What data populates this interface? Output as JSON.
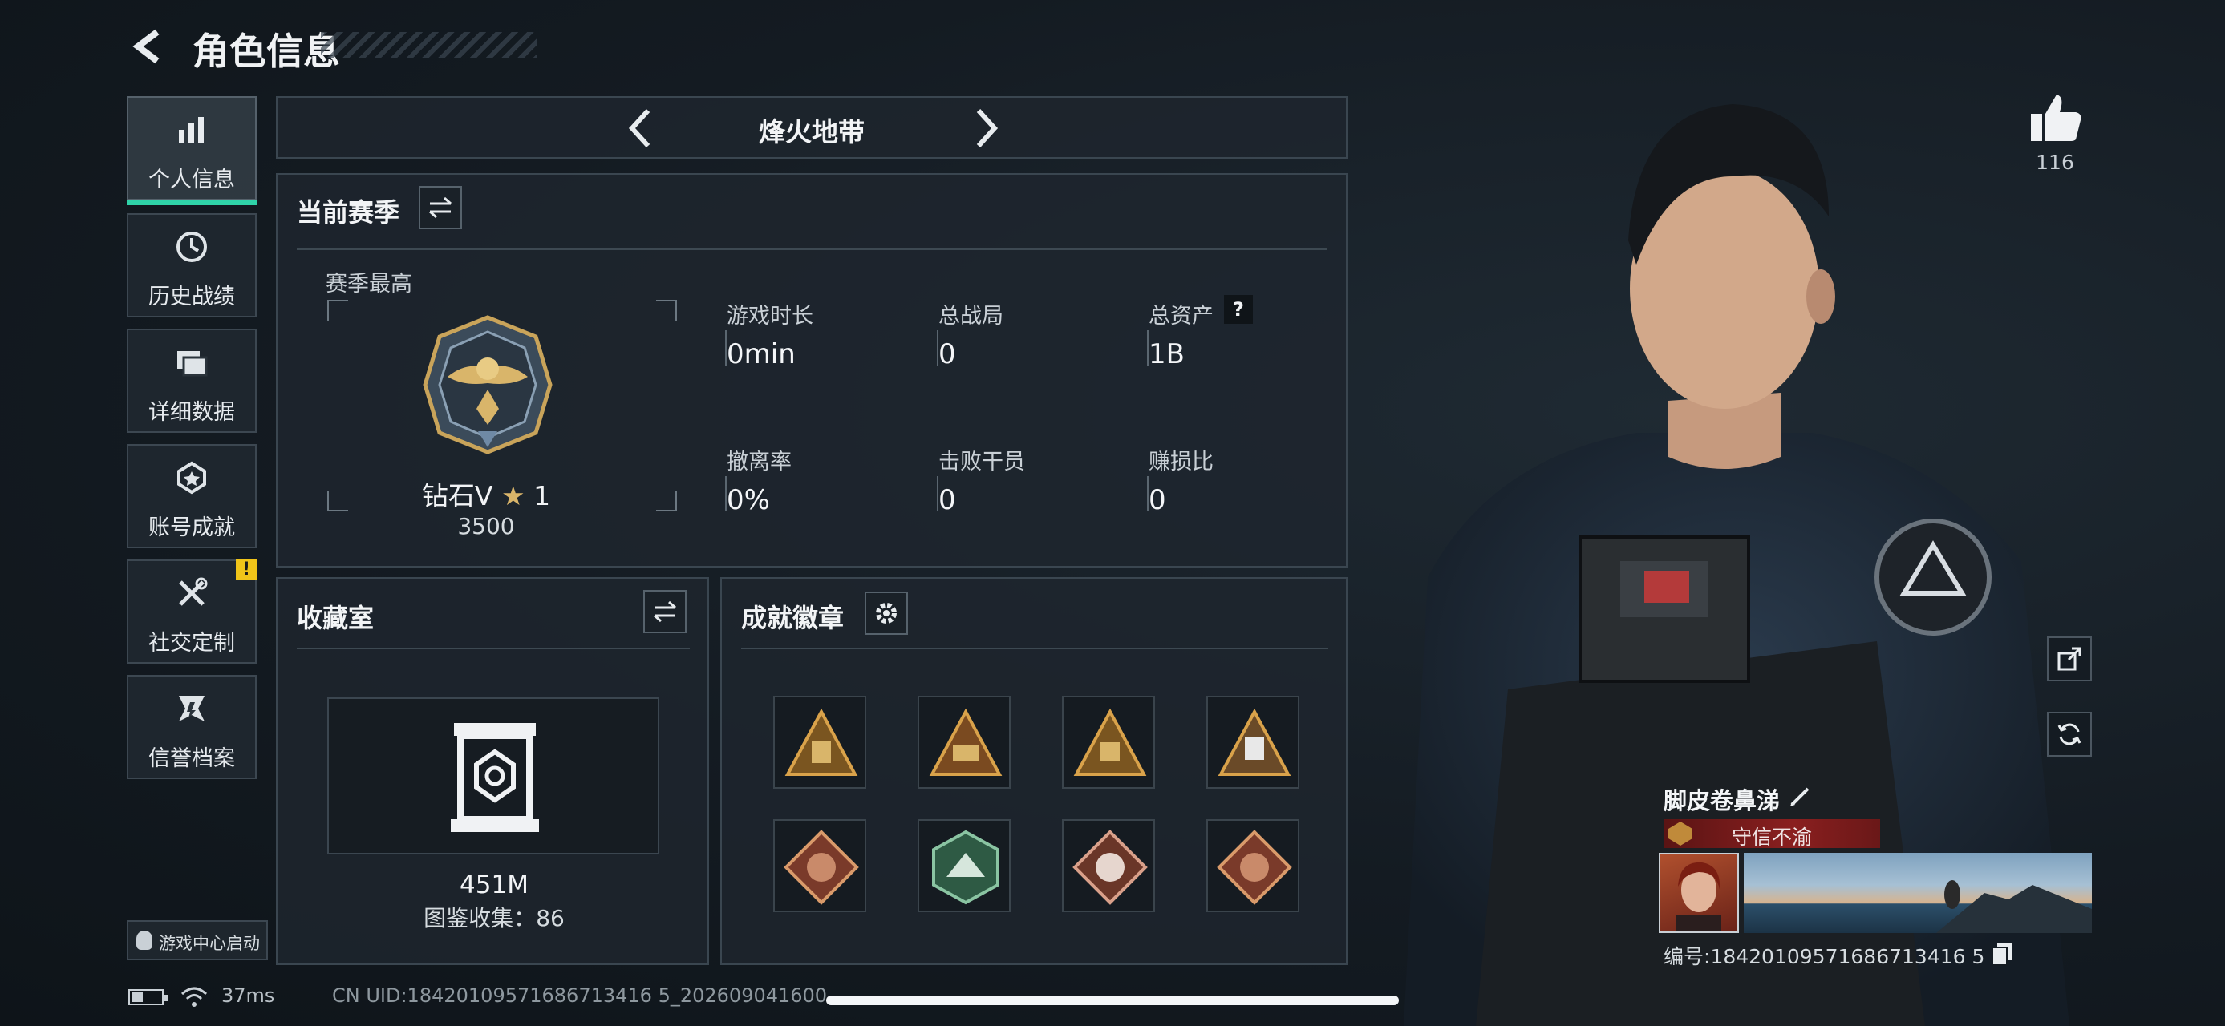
{
  "header": {
    "title": "角色信息"
  },
  "nav": {
    "items": [
      {
        "label": "个人信息",
        "icon": "bar-chart-icon"
      },
      {
        "label": "历史战绩",
        "icon": "history-icon"
      },
      {
        "label": "详细数据",
        "icon": "folders-icon"
      },
      {
        "label": "账号成就",
        "icon": "achievement-icon"
      },
      {
        "label": "社交定制",
        "icon": "tools-icon",
        "badge": "!"
      },
      {
        "label": "信誉档案",
        "icon": "credit-icon"
      }
    ],
    "game_center": "游戏中心启动"
  },
  "mode": {
    "title": "烽火地带"
  },
  "season": {
    "title": "当前赛季",
    "best_label": "赛季最高",
    "rank_name": "钻石V",
    "rank_stars": "1",
    "rank_points": "3500",
    "stats": [
      {
        "label": "游戏时长",
        "value": "0min"
      },
      {
        "label": "总战局",
        "value": "0"
      },
      {
        "label": "总资产",
        "value": "1B",
        "help": "?"
      },
      {
        "label": "撤离率",
        "value": "0%"
      },
      {
        "label": "击败干员",
        "value": "0"
      },
      {
        "label": "赚损比",
        "value": "0"
      }
    ]
  },
  "collection": {
    "title": "收藏室",
    "value": "451M",
    "codex_label": "图鉴收集：",
    "codex_count": "86"
  },
  "achievements": {
    "title": "成就徽章"
  },
  "player": {
    "likes": "116",
    "name": "脚皮卷鼻涕",
    "title_tag": "守信不渝",
    "id_label": "编号:",
    "id": "18420109571686713416 5"
  },
  "status": {
    "ping": "37ms",
    "uid": "CN UID:18420109571686713416 5_202609041600"
  },
  "colors": {
    "accent": "#2fd3a8",
    "warning": "#f0c419",
    "title_red": "#8a1f1f"
  }
}
